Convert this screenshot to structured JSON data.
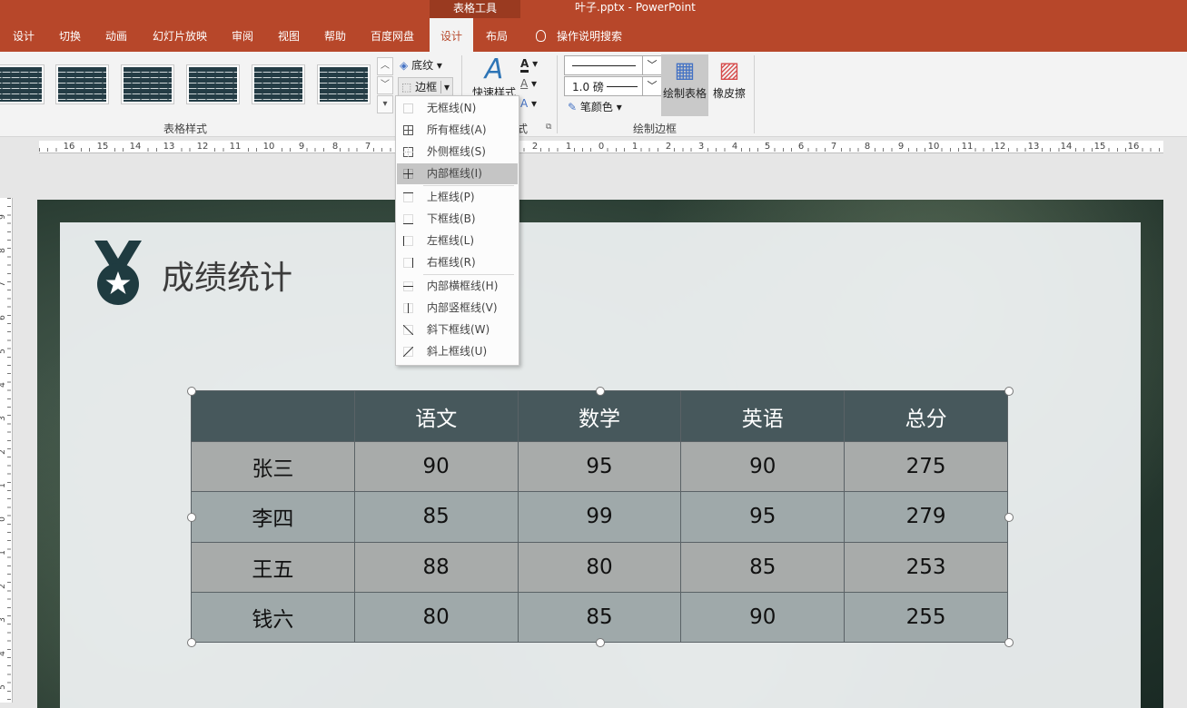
{
  "titlebar": {
    "contextual": "表格工具",
    "document": "叶子.pptx  -  PowerPoint"
  },
  "tabs": [
    {
      "label": "设计"
    },
    {
      "label": "切换"
    },
    {
      "label": "动画"
    },
    {
      "label": "幻灯片放映"
    },
    {
      "label": "审阅"
    },
    {
      "label": "视图"
    },
    {
      "label": "帮助"
    },
    {
      "label": "百度网盘"
    },
    {
      "label": "设计"
    },
    {
      "label": "布局"
    }
  ],
  "tell_me": "操作说明搜索",
  "ribbon": {
    "table_styles_label": "表格样式",
    "shading": "底纹",
    "borders": "边框",
    "quick_styles": "快速样式",
    "wordart_label_fragment": "式",
    "pen_weight": "1.0 磅",
    "pen_color": "笔颜色",
    "draw_table": "绘制表格",
    "eraser": "橡皮擦",
    "draw_borders_label": "绘制边框"
  },
  "border_menu": [
    {
      "label": "无框线(N)",
      "icon": "no-border-icon"
    },
    {
      "label": "所有框线(A)",
      "icon": "all-borders-icon"
    },
    {
      "label": "外侧框线(S)",
      "icon": "outside-borders-icon"
    },
    {
      "label": "内部框线(I)",
      "icon": "inside-borders-icon"
    },
    {
      "label": "上框线(P)",
      "icon": "top-border-icon"
    },
    {
      "label": "下框线(B)",
      "icon": "bottom-border-icon"
    },
    {
      "label": "左框线(L)",
      "icon": "left-border-icon"
    },
    {
      "label": "右框线(R)",
      "icon": "right-border-icon"
    },
    {
      "label": "内部横框线(H)",
      "icon": "inside-horizontal-border-icon"
    },
    {
      "label": "内部竖框线(V)",
      "icon": "inside-vertical-border-icon"
    },
    {
      "label": "斜下框线(W)",
      "icon": "diagonal-down-border-icon"
    },
    {
      "label": "斜上框线(U)",
      "icon": "diagonal-up-border-icon"
    }
  ],
  "ruler_h": [
    "16",
    "15",
    "14",
    "13",
    "12",
    "11",
    "10",
    "9",
    "8",
    "7",
    "2",
    "1",
    "0",
    "1",
    "2",
    "3",
    "4",
    "5",
    "6",
    "7",
    "8",
    "9",
    "10",
    "11",
    "12",
    "13",
    "14",
    "15",
    "16"
  ],
  "ruler_v": [
    "9",
    "8",
    "7",
    "6",
    "5",
    "4",
    "3",
    "2",
    "1",
    "0",
    "1",
    "2",
    "3",
    "4",
    "5"
  ],
  "slide": {
    "title": "成绩统计",
    "table": {
      "headers": [
        "",
        "语文",
        "数学",
        "英语",
        "总分"
      ],
      "rows": [
        [
          "张三",
          "90",
          "95",
          "90",
          "275"
        ],
        [
          "李四",
          "85",
          "99",
          "95",
          "279"
        ],
        [
          "王五",
          "88",
          "80",
          "85",
          "253"
        ],
        [
          "钱六",
          "80",
          "85",
          "90",
          "255"
        ]
      ]
    }
  },
  "colors": {
    "accent": "#b7472a",
    "table_header": "#47585c",
    "medal": "#1f3b40"
  }
}
